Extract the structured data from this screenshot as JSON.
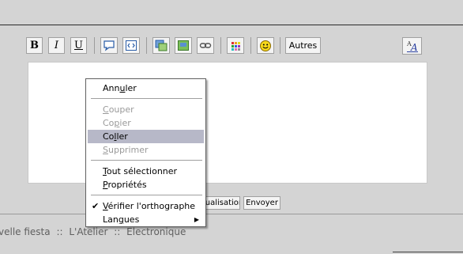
{
  "toolbar": {
    "bold_label": "B",
    "italic_label": "I",
    "underline_label": "U",
    "autres_label": "Autres"
  },
  "buttons": {
    "visualisation_label": "isualisation",
    "envoyer_label": "Envoyer"
  },
  "breadcrumb": {
    "item1": "velle fiesta",
    "sep": "::",
    "item2": "L'Atelier",
    "item3": "Electronique"
  },
  "context_menu": {
    "items": [
      {
        "pre": "Ann",
        "ul": "u",
        "post": "ler",
        "disabled": false
      },
      {
        "pre": "",
        "ul": "C",
        "post": "ouper",
        "disabled": true
      },
      {
        "pre": "Co",
        "ul": "p",
        "post": "ier",
        "disabled": true
      },
      {
        "pre": "Co",
        "ul": "l",
        "post": "ler",
        "disabled": false,
        "highlighted": true
      },
      {
        "pre": "",
        "ul": "S",
        "post": "upprimer",
        "disabled": true
      },
      {
        "pre": "",
        "ul": "T",
        "post": "out sélectionner",
        "disabled": false
      },
      {
        "pre": "",
        "ul": "P",
        "post": "ropriétés",
        "disabled": false
      },
      {
        "pre": "",
        "ul": "V",
        "post": "érifier l'orthographe",
        "disabled": false,
        "checked": true
      },
      {
        "pre": "Lan",
        "ul": "g",
        "post": "ues",
        "disabled": false,
        "submenu": true
      }
    ]
  },
  "colors": {
    "background": "#d4d4d4",
    "highlight": "#b7b8c8",
    "disabled_text": "#9a9a9a"
  }
}
